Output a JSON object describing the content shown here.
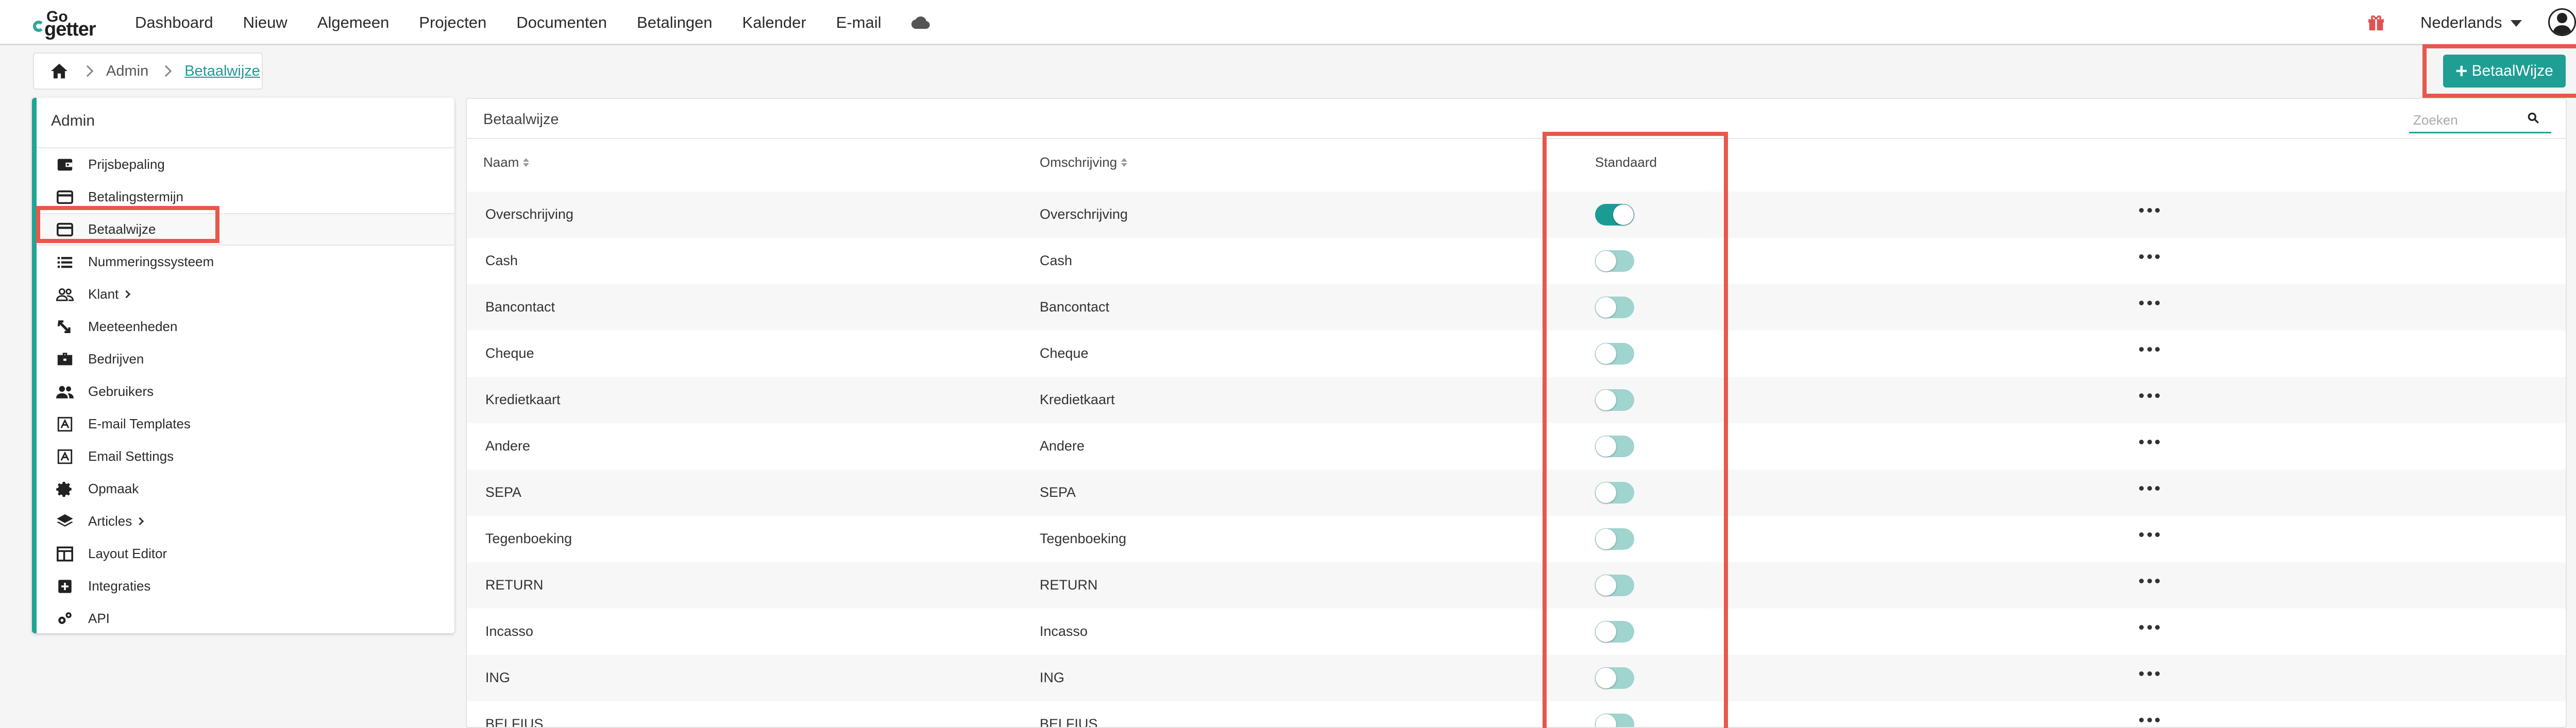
{
  "nav": {
    "logo_top": "Go",
    "logo_bottom": "getter",
    "items": [
      "Dashboard",
      "Nieuw",
      "Algemeen",
      "Projecten",
      "Documenten",
      "Betalingen",
      "Kalender",
      "E-mail"
    ],
    "language": "Nederlands"
  },
  "breadcrumb": {
    "admin": "Admin",
    "current": "Betaalwijze"
  },
  "actions": {
    "add_label": "BetaalWijze"
  },
  "sidebar": {
    "title": "Admin",
    "items": [
      {
        "label": "Prijsbepaling",
        "icon": "wallet-icon"
      },
      {
        "label": "Betalingstermijn",
        "icon": "credit-card-icon"
      },
      {
        "label": "Betaalwijze",
        "icon": "credit-card-icon",
        "selected": true
      },
      {
        "label": "Nummeringssysteem",
        "icon": "list-icon"
      },
      {
        "label": "Klant",
        "icon": "people-icon",
        "expandable": true
      },
      {
        "label": "Meeteenheden",
        "icon": "resize-icon"
      },
      {
        "label": "Bedrijven",
        "icon": "briefcase-icon"
      },
      {
        "label": "Gebruikers",
        "icon": "users-icon"
      },
      {
        "label": "E-mail Templates",
        "icon": "template-icon"
      },
      {
        "label": "Email Settings",
        "icon": "template-icon"
      },
      {
        "label": "Opmaak",
        "icon": "gear-icon"
      },
      {
        "label": "Articles",
        "icon": "layers-icon",
        "expandable": true
      },
      {
        "label": "Layout Editor",
        "icon": "layout-icon"
      },
      {
        "label": "Integraties",
        "icon": "plus-box-icon"
      },
      {
        "label": "API",
        "icon": "gears-icon"
      }
    ]
  },
  "table": {
    "title": "Betaalwijze",
    "search_placeholder": "Zoeken",
    "columns": {
      "name": "Naam",
      "description": "Omschrijving",
      "default": "Standaard"
    },
    "rows": [
      {
        "name": "Overschrijving",
        "description": "Overschrijving",
        "default": true
      },
      {
        "name": "Cash",
        "description": "Cash",
        "default": false
      },
      {
        "name": "Bancontact",
        "description": "Bancontact",
        "default": false
      },
      {
        "name": "Cheque",
        "description": "Cheque",
        "default": false
      },
      {
        "name": "Kredietkaart",
        "description": "Kredietkaart",
        "default": false
      },
      {
        "name": "Andere",
        "description": "Andere",
        "default": false
      },
      {
        "name": "SEPA",
        "description": "SEPA",
        "default": false
      },
      {
        "name": "Tegenboeking",
        "description": "Tegenboeking",
        "default": false
      },
      {
        "name": "RETURN",
        "description": "RETURN",
        "default": false
      },
      {
        "name": "Incasso",
        "description": "Incasso",
        "default": false
      },
      {
        "name": "ING",
        "description": "ING",
        "default": false
      },
      {
        "name": "BELFIUS",
        "description": "BELFIUS",
        "default": false
      }
    ]
  },
  "colors": {
    "accent": "#1f9e94",
    "highlight": "#e8574b",
    "toggle_off": "#9fd4cf",
    "gift": "#e05252"
  }
}
